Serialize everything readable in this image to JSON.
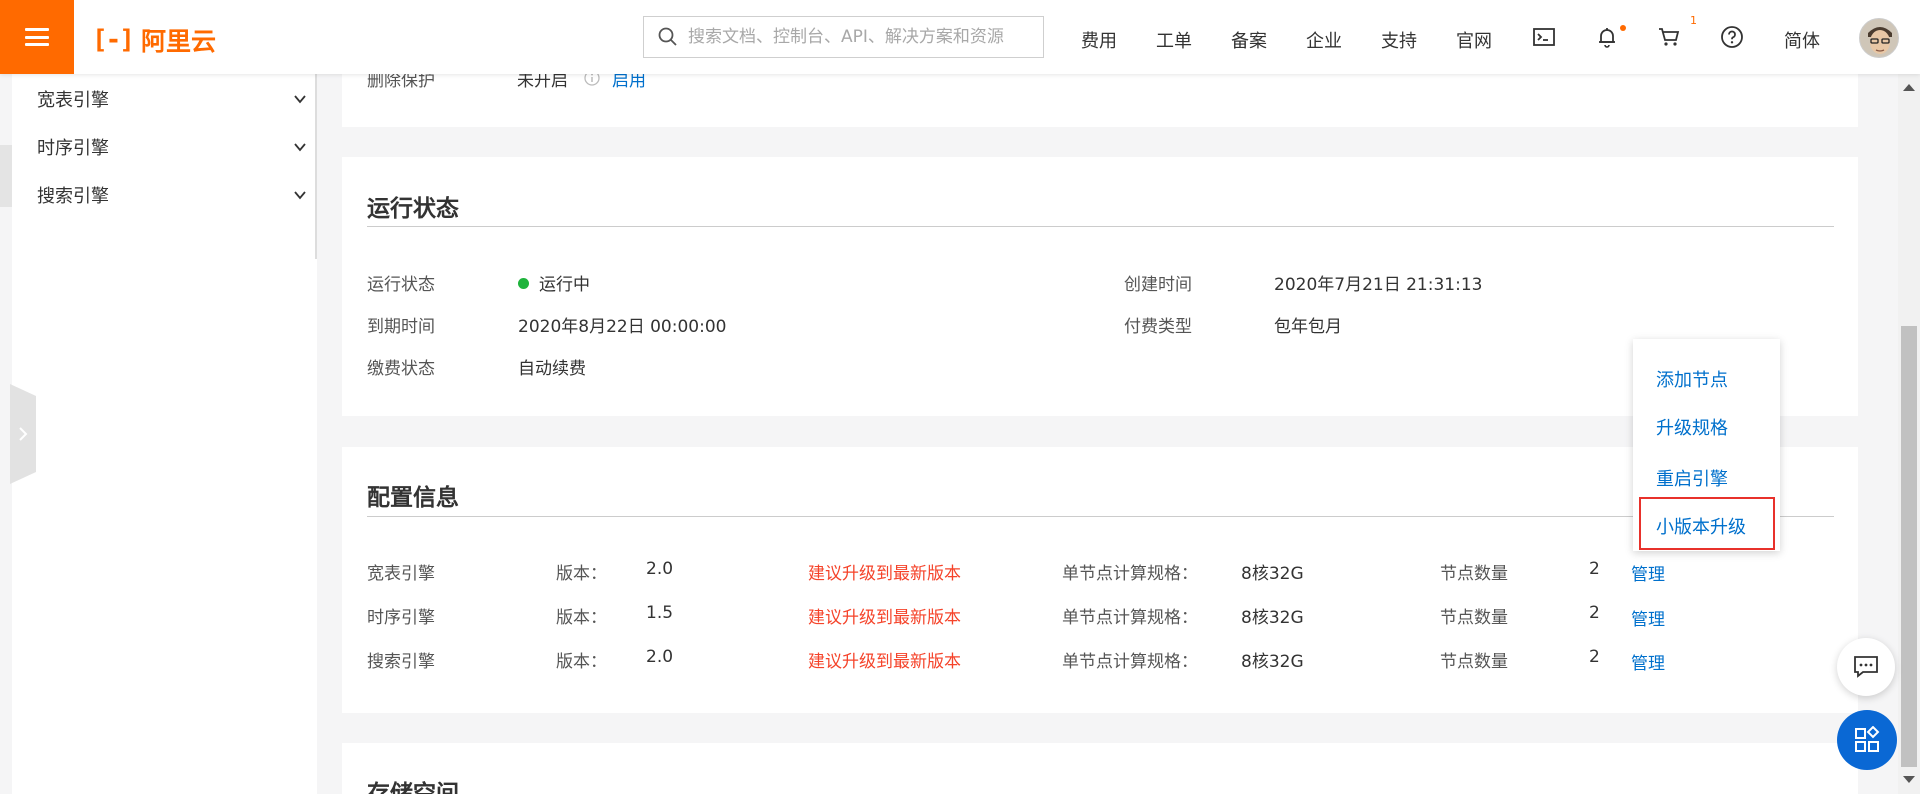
{
  "header": {
    "logo_text": "阿里云",
    "search_placeholder": "搜索文档、控制台、API、解决方案和资源",
    "nav": [
      "费用",
      "工单",
      "备案",
      "企业",
      "支持",
      "官网"
    ],
    "cart_count": "1",
    "language": "简体"
  },
  "sidebar": {
    "items": [
      {
        "label": "宽表引擎"
      },
      {
        "label": "时序引擎"
      },
      {
        "label": "搜索引擎"
      }
    ]
  },
  "top_card": {
    "label": "删除保护",
    "value": "未开启",
    "action": "启用"
  },
  "run_status": {
    "title": "运行状态",
    "rows": [
      {
        "label": "运行状态",
        "value": "运行中"
      },
      {
        "label": "到期时间",
        "value": "2020年8月22日 00:00:00"
      },
      {
        "label": "缴费状态",
        "value": "自动续费"
      }
    ],
    "right_rows": [
      {
        "label": "创建时间",
        "value": "2020年7月21日 21:31:13"
      },
      {
        "label": "付费类型",
        "value": "包年包月"
      }
    ],
    "status_color": "#1fb33c"
  },
  "config": {
    "title": "配置信息",
    "version_label": "版本：",
    "spec_label": "单节点计算规格：",
    "node_label": "节点数量",
    "manage_label": "管理",
    "rows": [
      {
        "engine": "宽表引擎",
        "version": "2.0",
        "advice": "建议升级到最新版本",
        "spec": "8核32G",
        "nodes": "2"
      },
      {
        "engine": "时序引擎",
        "version": "1.5",
        "advice": "建议升级到最新版本",
        "spec": "8核32G",
        "nodes": "2"
      },
      {
        "engine": "搜索引擎",
        "version": "2.0",
        "advice": "建议升级到最新版本",
        "spec": "8核32G",
        "nodes": "2"
      }
    ]
  },
  "storage": {
    "title": "存储空间"
  },
  "dropdown": {
    "items": [
      "添加节点",
      "升级规格",
      "重启引擎",
      "小版本升级"
    ]
  },
  "colors": {
    "brand": "#ff6a00",
    "link": "#0070cc",
    "warning": "#f5432a",
    "highlight_border": "#e8312b"
  }
}
